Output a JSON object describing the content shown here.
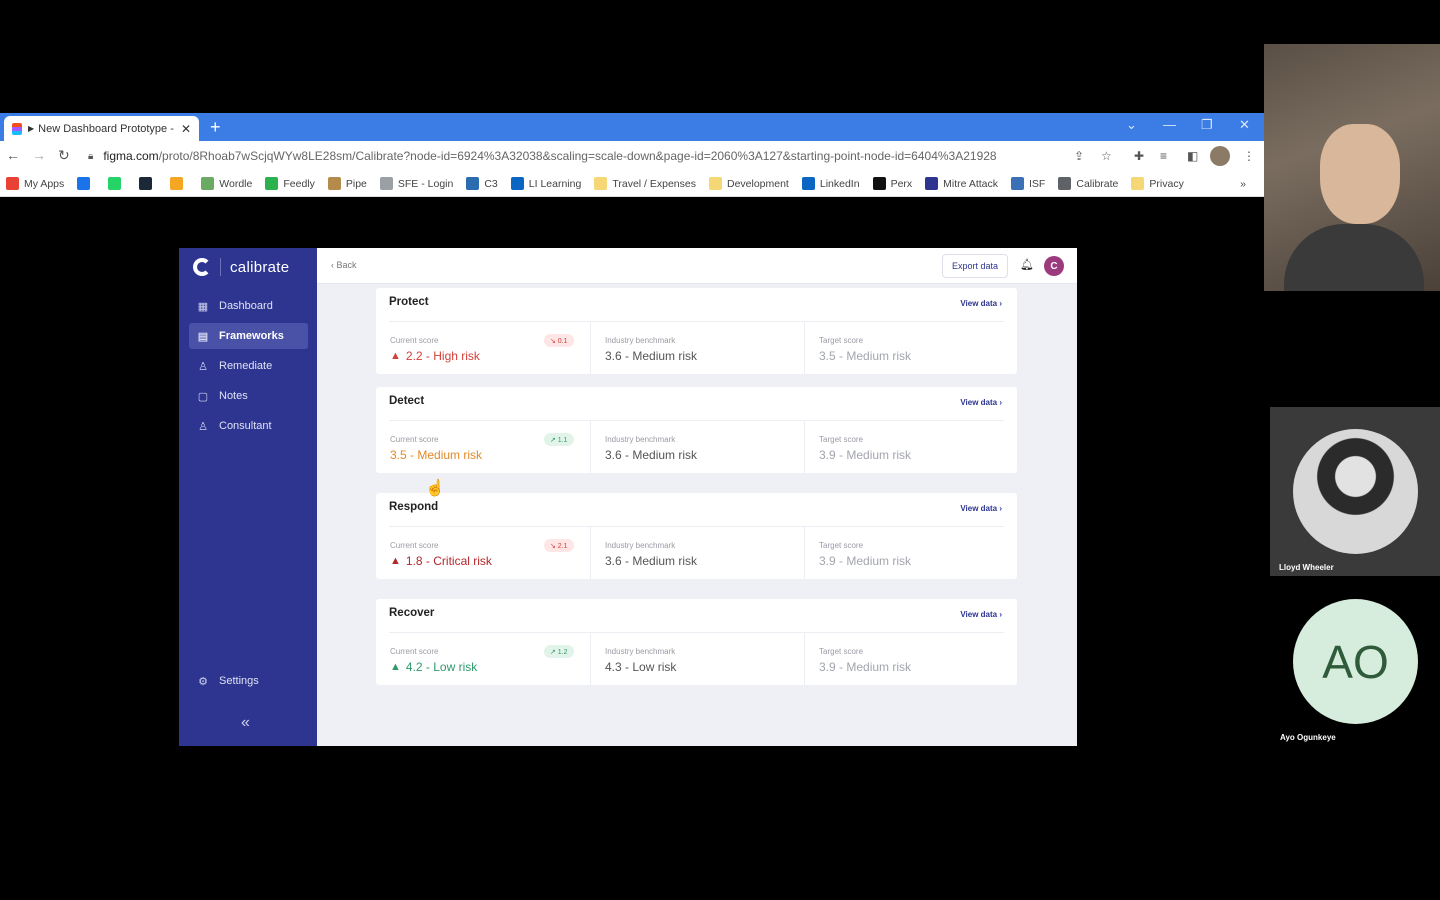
{
  "browser": {
    "tab_title": "New Dashboard Prototype - C",
    "url_host": "figma.com",
    "url_path": "/proto/8Rhoab7wScjqWYw8LE28sm/Calibrate?node-id=6924%3A32038&scaling=scale-down&page-id=2060%3A127&starting-point-node-id=6404%3A21928",
    "bookmarks": [
      {
        "label": "My Apps",
        "color": "#e94235"
      },
      {
        "label": "",
        "color": "#1a73e8"
      },
      {
        "label": "",
        "color": "#25d366"
      },
      {
        "label": "",
        "color": "#1b2838"
      },
      {
        "label": "",
        "color": "#f5a623"
      },
      {
        "label": "Wordle",
        "color": "#6aaa64"
      },
      {
        "label": "Feedly",
        "color": "#2bb24c"
      },
      {
        "label": "Pipe",
        "color": "#b58b4b"
      },
      {
        "label": "SFE - Login",
        "color": "#9aa0a6"
      },
      {
        "label": "C3",
        "color": "#2b6cb0"
      },
      {
        "label": "LI Learning",
        "color": "#0a66c2"
      },
      {
        "label": "Travel / Expenses",
        "color": "#f6d776"
      },
      {
        "label": "Development",
        "color": "#f6d776"
      },
      {
        "label": "LinkedIn",
        "color": "#0a66c2"
      },
      {
        "label": "Perx",
        "color": "#111111"
      },
      {
        "label": "Mitre Attack",
        "color": "#2d3591"
      },
      {
        "label": "ISF",
        "color": "#3b6fb6"
      },
      {
        "label": "Calibrate",
        "color": "#5f6368"
      },
      {
        "label": "Privacy",
        "color": "#f6d776"
      }
    ],
    "more": "»"
  },
  "app": {
    "brand": "calibrate",
    "nav": [
      {
        "label": "Dashboard",
        "icon": "grid-icon",
        "glyph": "▦"
      },
      {
        "label": "Frameworks",
        "icon": "document-icon",
        "glyph": "▤"
      },
      {
        "label": "Remediate",
        "icon": "user-gear-icon",
        "glyph": "♙"
      },
      {
        "label": "Notes",
        "icon": "note-icon",
        "glyph": "▢"
      },
      {
        "label": "Consultant",
        "icon": "person-icon",
        "glyph": "♙"
      }
    ],
    "settings_label": "Settings",
    "collapse_glyph": "«",
    "back_label": "‹ Back",
    "export_label": "Export data",
    "avatar_letter": "C",
    "view_data_label": "View data ›",
    "labels": {
      "current": "Current score",
      "benchmark": "Industry benchmark",
      "target": "Target score"
    },
    "cards": [
      {
        "title": "Protect",
        "current": {
          "value": "2.2 - High risk",
          "warn": "▲",
          "badge": "↘ 0.1",
          "trend": "down",
          "tone": "red"
        },
        "benchmark": "3.6 - Medium risk",
        "target": "3.5 - Medium risk"
      },
      {
        "title": "Detect",
        "current": {
          "value": "3.5 - Medium risk",
          "warn": "",
          "badge": "↗ 1.1",
          "trend": "up",
          "tone": "orange"
        },
        "benchmark": "3.6 - Medium risk",
        "target": "3.9 - Medium risk"
      },
      {
        "title": "Respond",
        "current": {
          "value": "1.8 - Critical risk",
          "warn": "▲",
          "badge": "↘ 2.1",
          "trend": "down",
          "tone": "crit"
        },
        "benchmark": "3.6 - Medium risk",
        "target": "3.9 - Medium risk"
      },
      {
        "title": "Recover",
        "current": {
          "value": "4.2 - Low risk",
          "warn": "▲",
          "badge": "↗ 1.2",
          "trend": "up",
          "tone": "green"
        },
        "benchmark": "4.3 - Low risk",
        "target": "3.9 - Medium risk"
      }
    ]
  },
  "video": {
    "participant_2": "Lloyd Wheeler",
    "participant_3_initials": "AO",
    "participant_3": "Ayo Ogunkeye"
  }
}
